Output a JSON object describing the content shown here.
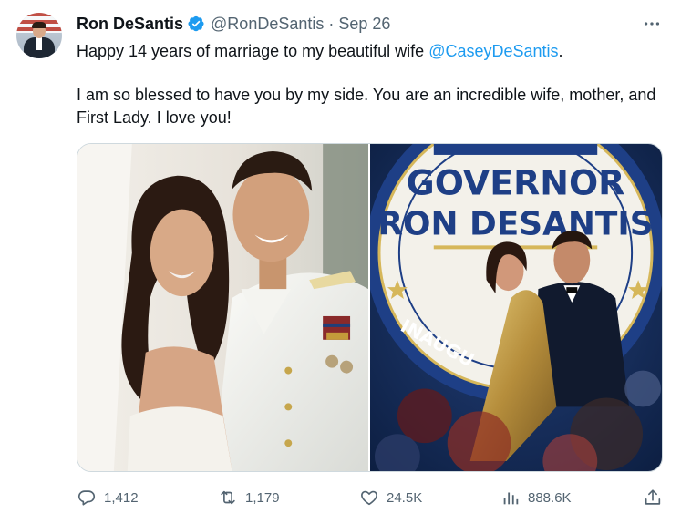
{
  "author": {
    "display_name": "Ron DeSantis",
    "handle": "@RonDeSantis",
    "separator": "·",
    "date": "Sep 26",
    "verified": true,
    "avatar_icon": "profile-photo"
  },
  "tweet": {
    "line1_prefix": "Happy 14 years of marriage to my beautiful wife ",
    "mention": "@CaseyDeSantis",
    "line1_suffix": ".",
    "paragraph2": "I am so blessed to have you by my side. You are an incredible wife, mother, and First Lady. I love you!"
  },
  "media": {
    "photos": [
      {
        "name": "wedding-photo"
      },
      {
        "name": "inaugural-ball-photo",
        "sign_line1": "GOVERNOR",
        "sign_line2": "RON DESANTIS",
        "seal_text": "INAUGU"
      }
    ]
  },
  "actions": {
    "replies": "1,412",
    "retweets": "1,179",
    "likes": "24.5K",
    "views": "888.6K"
  },
  "colors": {
    "accent": "#1d9bf0",
    "text_primary": "#0f1419",
    "text_secondary": "#536471",
    "border": "#cfd9de"
  }
}
